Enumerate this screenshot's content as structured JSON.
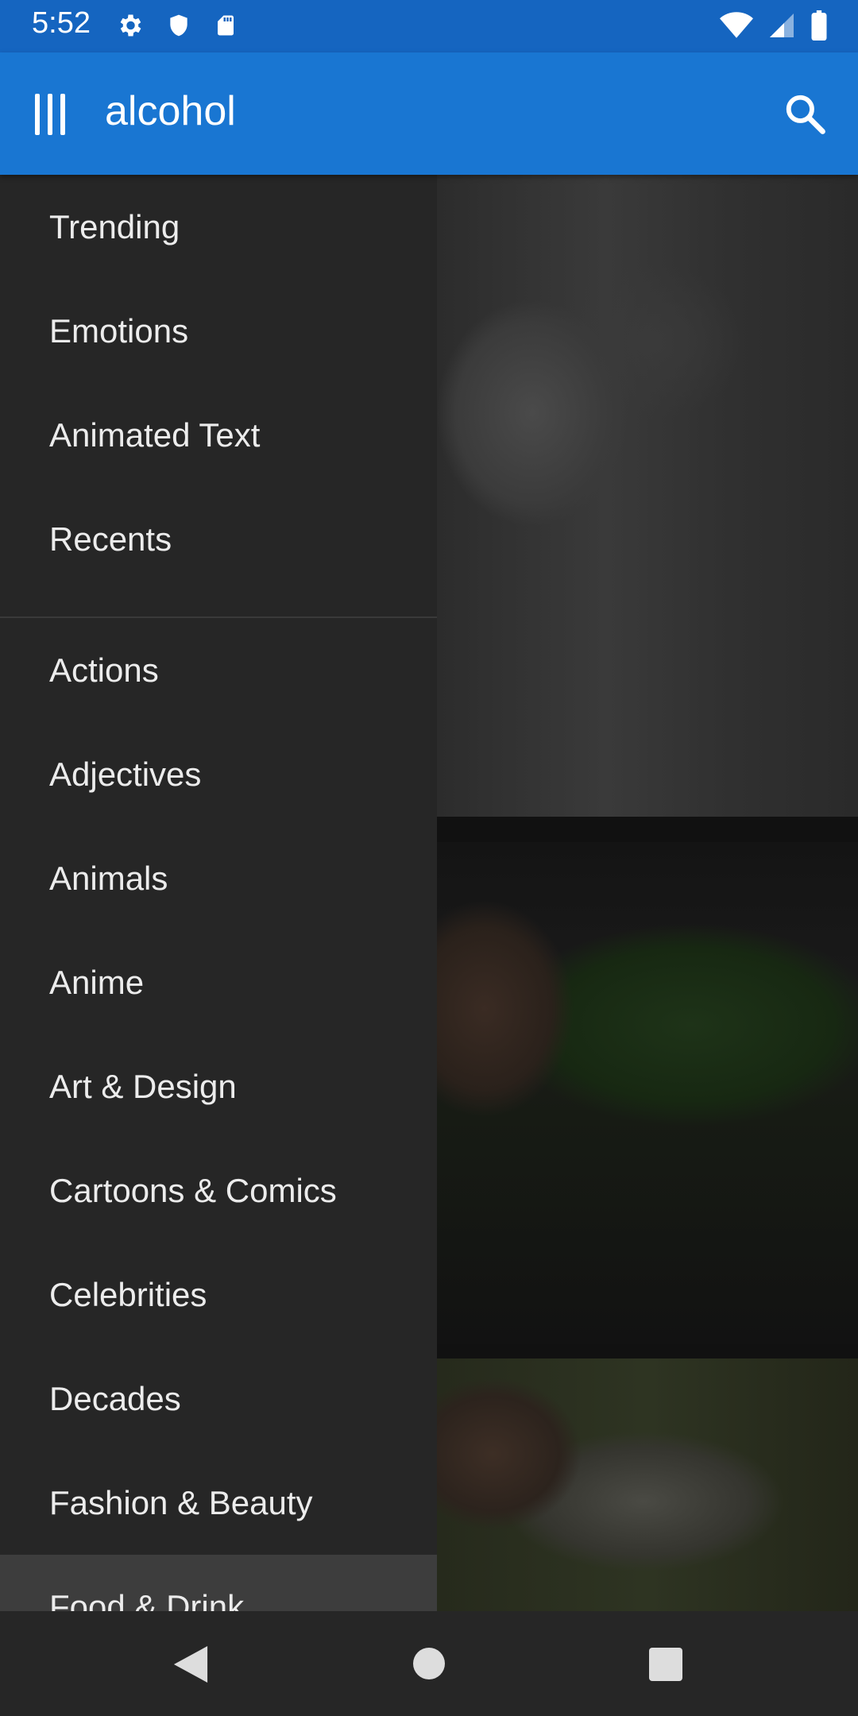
{
  "status_bar": {
    "time": "5:52",
    "icons_left": [
      "gear-icon",
      "shield-icon",
      "sd-card-icon"
    ],
    "icons_right": [
      "wifi-icon",
      "cell-signal-icon",
      "battery-icon"
    ]
  },
  "app_bar": {
    "query": "alcohol",
    "menu_icon": "menu-icon",
    "search_icon": "search-icon",
    "color": "#1976d2"
  },
  "drawer": {
    "section1": [
      {
        "label": "Trending"
      },
      {
        "label": "Emotions"
      },
      {
        "label": "Animated Text"
      },
      {
        "label": "Recents"
      }
    ],
    "section2": [
      {
        "label": "Actions"
      },
      {
        "label": "Adjectives"
      },
      {
        "label": "Animals"
      },
      {
        "label": "Anime"
      },
      {
        "label": "Art & Design"
      },
      {
        "label": "Cartoons & Comics"
      },
      {
        "label": "Celebrities"
      },
      {
        "label": "Decades"
      },
      {
        "label": "Fashion & Beauty"
      },
      {
        "label": "Food & Drink"
      }
    ],
    "selected": "Food & Drink"
  },
  "nav_bar": {
    "back": "back-icon",
    "home": "home-icon",
    "recents": "recents-icon"
  }
}
